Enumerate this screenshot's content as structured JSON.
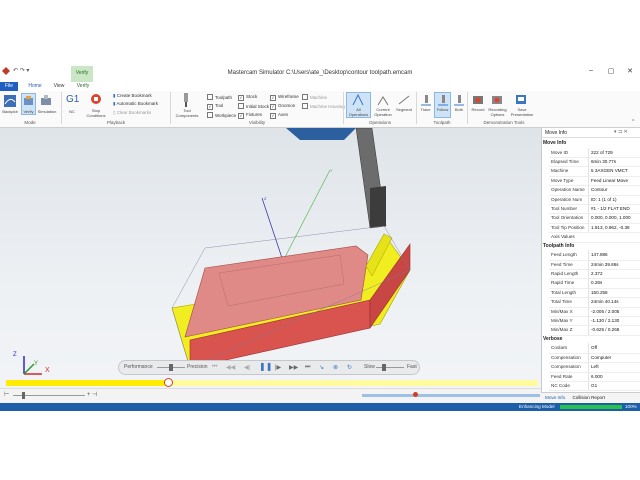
{
  "window": {
    "title": "Mastercam Simulator  C:\\Users\\ate_\\Desktop\\contour toolpath.emcam"
  },
  "tabs": {
    "file": "File",
    "home": "Home",
    "view": "View",
    "verify": "Verify",
    "verify_context": "Verify"
  },
  "ribbon": {
    "mode": {
      "backplot": "Backplot",
      "verify": "Verify",
      "simulation": "Simulation",
      "label": "Mode"
    },
    "playback": {
      "g1": "G1",
      "nc": "NC",
      "stop_conditions": "Stop Conditions",
      "create_bookmark": "Create Bookmark",
      "automatic_bookmark": "Automatic Bookmark",
      "clear_bookmarks": "Clear Bookmarks",
      "label": "Playback"
    },
    "visibility": {
      "tool_components": "Tool Components",
      "toolpath": "Toolpath",
      "tool": "Tool",
      "workpiece": "Workpiece",
      "stock": "Stock",
      "initial_stock": "Initial Stock",
      "fixtures": "Fixtures",
      "wireframe": "Wireframe",
      "grooves": "Gnomon",
      "axes": "Axes",
      "machine": "Machine",
      "machine_housing": "Machine Housing",
      "label": "Visibility"
    },
    "operations": {
      "all": "All Operations",
      "current": "Current Operation",
      "segment": "Segment",
      "label": "Operations"
    },
    "toolpath": {
      "trace": "Trace",
      "follow": "Follow",
      "both": "Both",
      "label": "Toolpath"
    },
    "demo": {
      "record": "Record",
      "recording_options": "Recording Options",
      "save_presentation": "Save Presentation",
      "label": "Demonstration Tools"
    }
  },
  "move_info": {
    "title": "Move Info",
    "sections": [
      {
        "name": "Move Info",
        "rows": [
          [
            "Move ID",
            "222 of 729"
          ],
          [
            "Elapsed Time",
            "6min 30.77s"
          ],
          [
            "Machine",
            "5 3AXGEN VMCT"
          ],
          [
            "Move Type",
            "Feed Linear Move"
          ],
          [
            "Operation Name",
            "Contour"
          ],
          [
            "Operation Num",
            "ID: 1 (1 of 1)"
          ],
          [
            "Tool Number",
            "#1 - 1/2 FLAT END"
          ],
          [
            "Tool Orientation",
            "0.000, 0.000, 1.000"
          ],
          [
            "Tool Tip Position",
            "1.913, 0.962, -0.38"
          ],
          [
            "Axis Values",
            ""
          ]
        ]
      },
      {
        "name": "Toolpath Info",
        "rows": [
          [
            "Feed Length",
            "147.886"
          ],
          [
            "Feed Time",
            "24min 39.86s"
          ],
          [
            "Rapid Length",
            "2.372"
          ],
          [
            "Rapid Time",
            "0.28s"
          ],
          [
            "Total Length",
            "150.258"
          ],
          [
            "Total Time",
            "24min 40.14s"
          ],
          [
            "Min/Max X",
            "-2.005 / 2.005"
          ],
          [
            "Min/Max Y",
            "-1.130 / 2.130"
          ],
          [
            "Min/Max Z",
            "-0.625 / 0.268"
          ]
        ]
      },
      {
        "name": "Verbose",
        "rows": [
          [
            "Coolant",
            "Off"
          ],
          [
            "Compensation",
            "Computer"
          ],
          [
            "Compensation",
            "Left"
          ],
          [
            "Feed Rate",
            "6.000"
          ],
          [
            "NC Code",
            "G1"
          ]
        ]
      }
    ],
    "tabs": [
      "Move Info",
      "Collision Report"
    ]
  },
  "playbar": {
    "performance": "Performance",
    "precision": "Precision",
    "slow": "Slow",
    "fast": "Fast"
  },
  "progress": {
    "fraction": 0.305
  },
  "status": {
    "text": "Enhancing Model",
    "percent": "100%",
    "fraction": 1.0
  },
  "axes_labels": {
    "x": "X",
    "y": "Y",
    "z": "Z"
  },
  "colors": {
    "stock_top": "#e08a87",
    "stock_side": "#d9534f",
    "cut": "#f0ee20",
    "accent": "#1e5fbf",
    "progress": "#ffec00"
  }
}
